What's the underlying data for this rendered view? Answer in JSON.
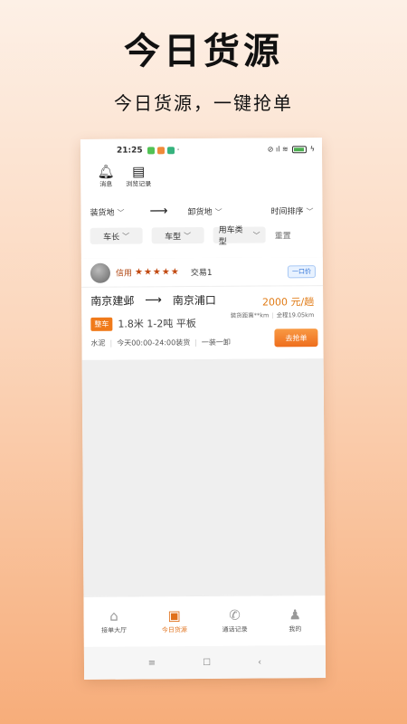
{
  "promo": {
    "title": "今日货源",
    "subtitle": "今日货源，一键抢单"
  },
  "status_bar": {
    "time": "21:25",
    "dot": "·",
    "right_indicators": "⊘ ıl ≋",
    "charging_icon": "ϟ"
  },
  "quick_icons": [
    {
      "label": "消息",
      "icon": "bell-icon",
      "glyph": "🔔︎"
    },
    {
      "label": "浏览记录",
      "icon": "document-icon",
      "glyph": "▤"
    }
  ],
  "filters": {
    "load_place": "装货地",
    "unload_place": "卸货地",
    "route_arrow": "⟶",
    "sort": "时间排序",
    "caret": "﹀",
    "chips": [
      "车长",
      "车型",
      "用车类型"
    ],
    "reset": "重置"
  },
  "order": {
    "credit_label": "信用",
    "stars": "★★★★★",
    "star_count": 5,
    "trade": "交易1",
    "price_type": "一口价",
    "from": "南京建邺",
    "to": "南京浦口",
    "arrow": "⟶",
    "price": "2000 元/趟",
    "load_distance": "装货距离**km",
    "total_distance": "全程19.05km",
    "tag": "整车",
    "spec": "1.8米 1-2吨 平板",
    "cargo": "水泥",
    "load_time": "今天00:00-24:00装货",
    "load_mode": "一装一卸",
    "grab_button": "去抢单"
  },
  "bottom_nav": [
    {
      "label": "接单大厅",
      "icon": "home-icon",
      "glyph": "⌂",
      "active": false
    },
    {
      "label": "今日货源",
      "icon": "cargo-box-icon",
      "glyph": "▣",
      "active": true
    },
    {
      "label": "通话记录",
      "icon": "phone-icon",
      "glyph": "✆",
      "active": false
    },
    {
      "label": "我的",
      "icon": "user-icon",
      "glyph": "♟",
      "active": false
    }
  ],
  "system_nav": {
    "menu": "≡",
    "home": "☐",
    "back": "‹"
  },
  "colors": {
    "accent": "#ee7a1c",
    "price_type_blue": "#2a6fd6",
    "star": "#c24a12"
  }
}
